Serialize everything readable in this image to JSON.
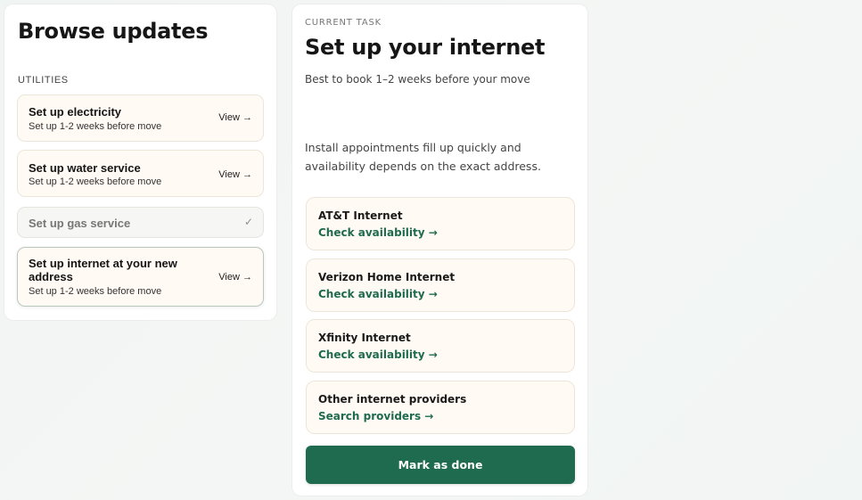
{
  "browse": {
    "title": "Browse updates",
    "section_label": "UTILITIES",
    "tasks": [
      {
        "title": "Set up electricity",
        "subtitle": "Set up 1-2 weeks before move",
        "action": "View →"
      },
      {
        "title": "Set up water service",
        "subtitle": "Set up 1-2 weeks before move",
        "action": "View →"
      },
      {
        "title": "Set up gas service",
        "status": "✓"
      },
      {
        "title_line1": "Set up internet at your new",
        "title_line2": "address",
        "subtitle": "Set up 1-2 weeks before move",
        "action": "View →"
      }
    ]
  },
  "current": {
    "eyebrow": "CURRENT TASK",
    "title": "Set up your internet",
    "subtitle": "Best to book 1–2 weeks before your move",
    "body": "Install appointments fill up quickly and availability depends on the exact address.",
    "providers": [
      {
        "name": "AT&T Internet",
        "link": "Check availability →"
      },
      {
        "name": "Verizon Home Internet",
        "link": "Check availability →"
      },
      {
        "name": "Xfinity Internet",
        "link": "Check availability →"
      },
      {
        "name": "Other internet providers",
        "link": "Search providers →"
      }
    ],
    "done_label": "Mark as done"
  },
  "colors": {
    "accent": "#1e6b4f",
    "card_bg": "#fffaf4",
    "page_bg": "#f2f5f3"
  }
}
